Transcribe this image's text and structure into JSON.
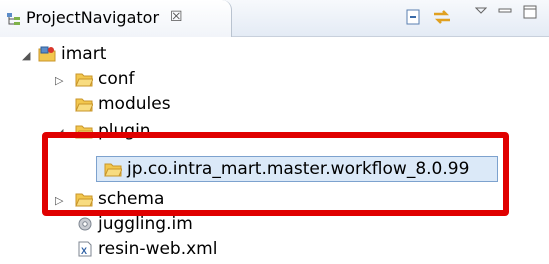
{
  "tab": {
    "title": "ProjectNavigator",
    "close": "☒"
  },
  "toolbar": {
    "collapse_icon": "collapse-all-icon",
    "link_icon": "link-with-editor-icon",
    "menu_icon": "view-menu-icon",
    "minimize_icon": "minimize-icon",
    "maximize_icon": "maximize-icon"
  },
  "tree": {
    "root": {
      "label": "imart",
      "expanded": true
    },
    "items": [
      {
        "label": "conf",
        "type": "folder",
        "expanded": false
      },
      {
        "label": "modules",
        "type": "folder"
      },
      {
        "label": "plugin",
        "type": "folder",
        "expanded": true
      },
      {
        "label": "jp.co.intra_mart.master.workflow_8.0.99",
        "type": "folder",
        "selected": true
      },
      {
        "label": "schema",
        "type": "folder",
        "expanded": false
      },
      {
        "label": "juggling.im",
        "type": "file-gear"
      },
      {
        "label": "resin-web.xml",
        "type": "file-xml"
      }
    ]
  },
  "colors": {
    "highlight_border": "#e00000",
    "selection_bg": "#dbe9f8",
    "folder": "#f2c74e"
  }
}
